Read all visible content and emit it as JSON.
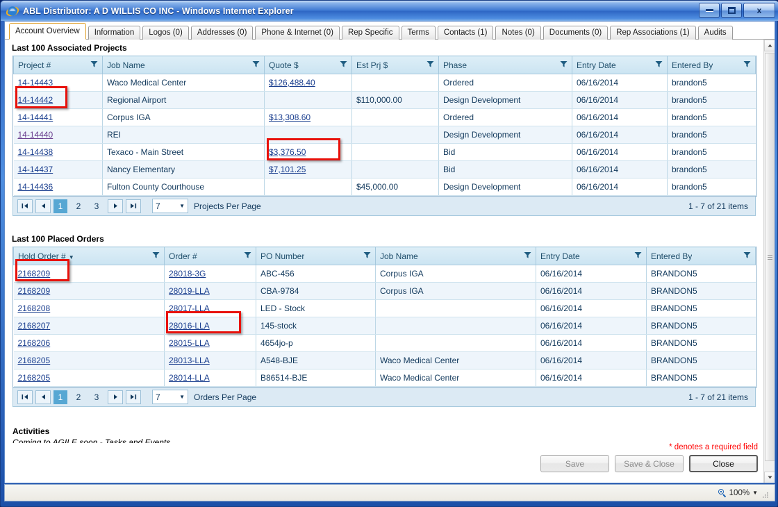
{
  "window": {
    "title": "ABL Distributor: A D WILLIS CO INC - Windows Internet Explorer",
    "minimize_label": "Minimize",
    "maximize_label": "Maximize",
    "close_label": "x"
  },
  "tabs": [
    {
      "label": "Account Overview",
      "active": true
    },
    {
      "label": "Information",
      "active": false
    },
    {
      "label": "Logos (0)",
      "active": false
    },
    {
      "label": "Addresses (0)",
      "active": false
    },
    {
      "label": "Phone & Internet (0)",
      "active": false
    },
    {
      "label": "Rep Specific",
      "active": false
    },
    {
      "label": "Terms",
      "active": false
    },
    {
      "label": "Contacts (1)",
      "active": false
    },
    {
      "label": "Notes (0)",
      "active": false
    },
    {
      "label": "Documents (0)",
      "active": false
    },
    {
      "label": "Rep Associations (1)",
      "active": false
    },
    {
      "label": "Audits",
      "active": false
    }
  ],
  "projects": {
    "title": "Last 100 Associated Projects",
    "columns": [
      "Project #",
      "Job Name",
      "Quote $",
      "Est Prj $",
      "Phase",
      "Entry Date",
      "Entered By"
    ],
    "rows": [
      {
        "project": "14-14443",
        "job": "Waco Medical Center",
        "quote": "$126,488.40",
        "est": "",
        "phase": "Ordered",
        "date": "06/16/2014",
        "by": "brandon5"
      },
      {
        "project": "14-14442",
        "job": "Regional Airport",
        "quote": "",
        "est": "$110,000.00",
        "phase": "Design Development",
        "date": "06/16/2014",
        "by": "brandon5"
      },
      {
        "project": "14-14441",
        "job": "Corpus IGA",
        "quote": "$13,308.60",
        "est": "",
        "phase": "Ordered",
        "date": "06/16/2014",
        "by": "brandon5"
      },
      {
        "project": "14-14440",
        "job": "REI",
        "quote": "",
        "est": "",
        "phase": "Design Development",
        "date": "06/16/2014",
        "by": "brandon5"
      },
      {
        "project": "14-14438",
        "job": "Texaco - Main Street",
        "quote": "$3,376.50",
        "est": "",
        "phase": "Bid",
        "date": "06/16/2014",
        "by": "brandon5"
      },
      {
        "project": "14-14437",
        "job": "Nancy Elementary",
        "quote": "$7,101.25",
        "est": "",
        "phase": "Bid",
        "date": "06/16/2014",
        "by": "brandon5"
      },
      {
        "project": "14-14436",
        "job": "Fulton County Courthouse",
        "quote": "",
        "est": "$45,000.00",
        "phase": "Design Development",
        "date": "06/16/2014",
        "by": "brandon5"
      }
    ],
    "pager": {
      "first": "|◀",
      "prev": "◀",
      "next": "▶",
      "last": "▶|",
      "pages": [
        "1",
        "2",
        "3"
      ],
      "current_page": "1",
      "per_page_value": "7",
      "per_page_label": "Projects Per Page",
      "items_text": "1 - 7 of 21 items"
    }
  },
  "orders": {
    "title": "Last 100 Placed Orders",
    "columns": [
      "Hold Order #",
      "Order #",
      "PO Number",
      "Job Name",
      "Entry Date",
      "Entered By"
    ],
    "sorted_column": "Hold Order #",
    "sort_arrow": "▼",
    "rows": [
      {
        "hold": "2168209",
        "order": "28018-3G",
        "po": "ABC-456",
        "job": "Corpus IGA",
        "date": "06/16/2014",
        "by": "BRANDON5"
      },
      {
        "hold": "2168209",
        "order": "28019-LLA",
        "po": "CBA-9784",
        "job": "Corpus IGA",
        "date": "06/16/2014",
        "by": "BRANDON5"
      },
      {
        "hold": "2168208",
        "order": "28017-LLA",
        "po": "LED - Stock",
        "job": "",
        "date": "06/16/2014",
        "by": "BRANDON5"
      },
      {
        "hold": "2168207",
        "order": "28016-LLA",
        "po": "145-stock",
        "job": "",
        "date": "06/16/2014",
        "by": "BRANDON5"
      },
      {
        "hold": "2168206",
        "order": "28015-LLA",
        "po": "4654jo-p",
        "job": "",
        "date": "06/16/2014",
        "by": "BRANDON5"
      },
      {
        "hold": "2168205",
        "order": "28013-LLA",
        "po": "A548-BJE",
        "job": "Waco Medical Center",
        "date": "06/16/2014",
        "by": "BRANDON5"
      },
      {
        "hold": "2168205",
        "order": "28014-LLA",
        "po": "B86514-BJE",
        "job": "Waco Medical Center",
        "date": "06/16/2014",
        "by": "BRANDON5"
      }
    ],
    "pager": {
      "first": "|◀",
      "prev": "◀",
      "next": "▶",
      "last": "▶|",
      "pages": [
        "1",
        "2",
        "3"
      ],
      "current_page": "1",
      "per_page_value": "7",
      "per_page_label": "Orders Per Page",
      "items_text": "1 - 7 of 21 items"
    }
  },
  "activities": {
    "heading": "Activities",
    "subtext": "Coming to AGILE soon - Tasks and Events"
  },
  "footer": {
    "required_note": "* denotes a required field",
    "save_label": "Save",
    "save_close_label": "Save & Close",
    "close_label": "Close"
  },
  "statusbar": {
    "zoom_label": "100%",
    "zoom_caret": "▼"
  },
  "colors": {
    "accent": "#57a7d3",
    "header_bg": "#cbe4f2",
    "link": "#1b3f8f",
    "highlight": "#e8120c",
    "required": "#ff0000"
  }
}
